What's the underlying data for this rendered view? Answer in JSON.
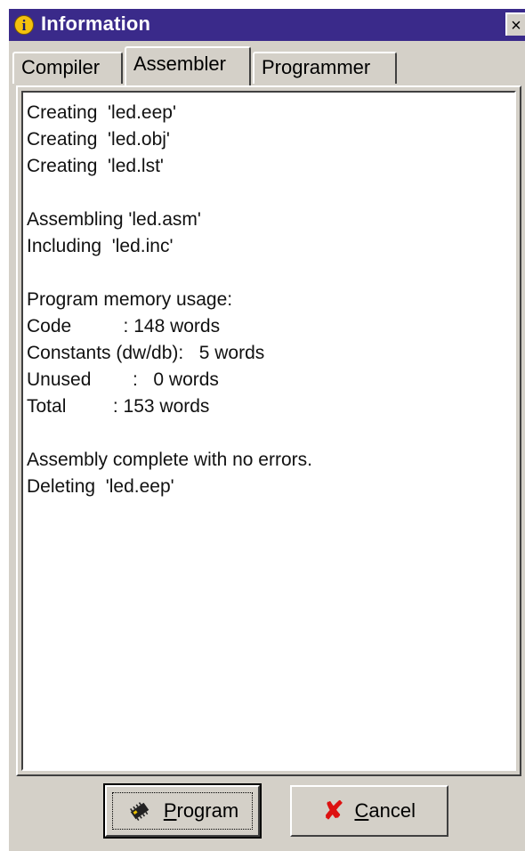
{
  "window": {
    "title": "Information",
    "info_icon_glyph": "i",
    "close_glyph": "×"
  },
  "tabs": [
    {
      "label": "Compiler",
      "active": false
    },
    {
      "label": "Assembler",
      "active": true
    },
    {
      "label": "Programmer",
      "active": false
    }
  ],
  "output": {
    "lines": [
      "Creating  'led.eep'",
      "Creating  'led.obj'",
      "Creating  'led.lst'",
      "",
      "Assembling 'led.asm'",
      "Including  'led.inc'",
      "",
      "Program memory usage:",
      "Code          : 148 words",
      "Constants (dw/db):   5 words",
      "Unused        :   0 words",
      "Total         : 153 words",
      "",
      "Assembly complete with no errors.",
      "Deleting  'led.eep'"
    ]
  },
  "buttons": {
    "program": {
      "accel": "P",
      "rest": "rogram",
      "icon": "chip-icon"
    },
    "cancel": {
      "accel": "C",
      "rest": "ancel",
      "icon": "red-x-icon"
    }
  },
  "colors": {
    "titlebar": "#3a2a8a",
    "dialog": "#d4d0c8",
    "cancel_x": "#dd1111"
  }
}
